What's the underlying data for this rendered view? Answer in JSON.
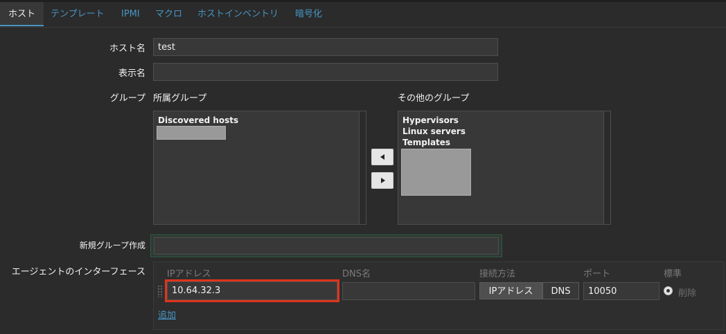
{
  "tabs": [
    {
      "label": "ホスト",
      "active": true
    },
    {
      "label": "テンプレート"
    },
    {
      "label": "IPMI"
    },
    {
      "label": "マクロ"
    },
    {
      "label": "ホストインベントリ"
    },
    {
      "label": "暗号化"
    }
  ],
  "form": {
    "host_name_label": "ホスト名",
    "host_name_value": "test",
    "display_name_label": "表示名",
    "display_name_value": "",
    "groups_label": "グループ",
    "member_groups_title": "所属グループ",
    "member_groups": [
      "Discovered hosts"
    ],
    "other_groups_title": "その他のグループ",
    "other_groups": [
      "Hypervisors",
      "Linux servers",
      "Templates"
    ],
    "new_group_label": "新規グループ作成",
    "new_group_value": "",
    "agent_interfaces_label": "エージェントのインターフェース"
  },
  "interfaces": {
    "headers": {
      "ip": "IPアドレス",
      "dns": "DNS名",
      "connect": "接続方法",
      "port": "ポート",
      "default": "標準"
    },
    "row": {
      "ip": "10.64.32.3",
      "dns": "",
      "connect_ip": "IPアドレス",
      "connect_dns": "DNS",
      "port": "10050",
      "remove": "削除"
    },
    "add_link": "追加"
  },
  "colors": {
    "accent": "#4796c4",
    "highlight_border": "#e0341c",
    "new_group_border": "#2e5a43"
  }
}
